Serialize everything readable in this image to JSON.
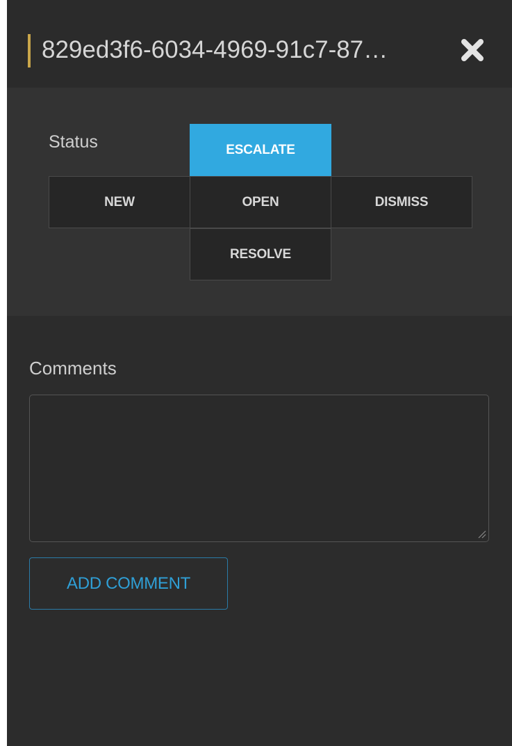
{
  "header": {
    "title": "829ed3f6-6034-4969-91c7-87…",
    "close_icon": "close-x-icon"
  },
  "status": {
    "label": "Status",
    "buttons": {
      "escalate": "ESCALATE",
      "new": "NEW",
      "open": "OPEN",
      "dismiss": "DISMISS",
      "resolve": "RESOLVE"
    },
    "active": "ESCALATE"
  },
  "comments": {
    "label": "Comments",
    "value": "",
    "add_button_label": "ADD COMMENT"
  },
  "colors": {
    "accent_bar": "#c9a64a",
    "active_button": "#31a9e0",
    "add_button_text": "#2f9fd6",
    "panel_background": "#2c2c2c"
  }
}
